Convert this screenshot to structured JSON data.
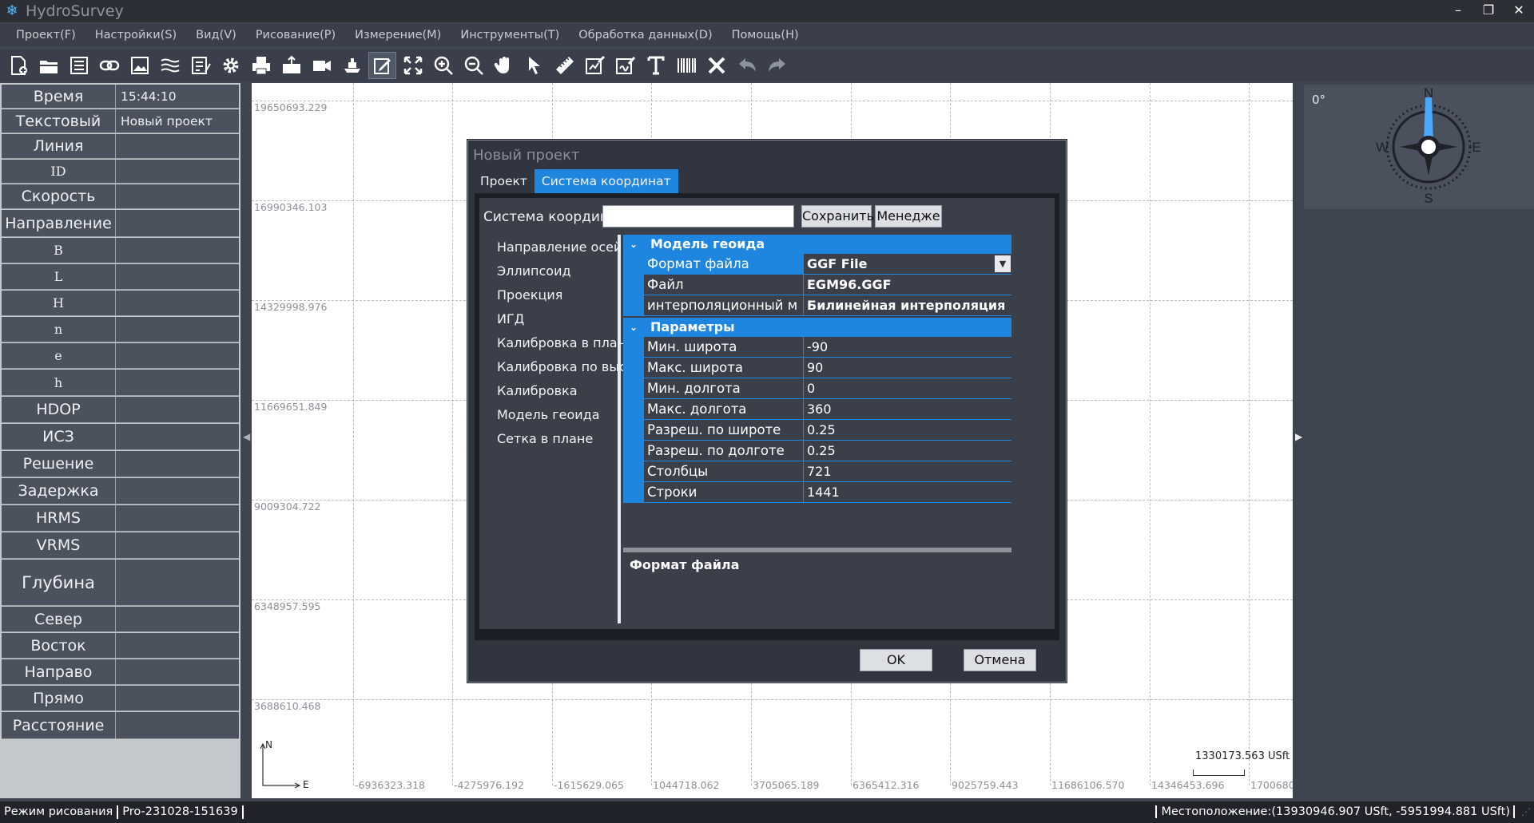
{
  "app": {
    "title": "HydroSurvey"
  },
  "menu": [
    "Проект(F)",
    "Настройки(S)",
    "Вид(V)",
    "Рисование(P)",
    "Измерение(M)",
    "Инструменты(T)",
    "Обработка данных(D)",
    "Помощь(H)"
  ],
  "toolbar_icons": [
    "new-file-icon",
    "open-folder-icon",
    "save-icon",
    "link-icon",
    "image-icon",
    "layers-icon",
    "document-edit-icon",
    "gear-icon",
    "print-icon",
    "export-icon",
    "camera-icon",
    "ship-icon",
    "edit-icon",
    "fullscreen-icon",
    "zoom-in-icon",
    "zoom-out-icon",
    "hand-icon",
    "pointer-icon",
    "ruler-icon",
    "chart-edit-icon",
    "signature-icon",
    "text-icon",
    "barcode-icon",
    "delete-icon",
    "undo-icon",
    "redo-icon"
  ],
  "left_panel": [
    {
      "label": "Время",
      "value": "15:44:10"
    },
    {
      "label": "Текстовый",
      "value": "Новый проект"
    },
    {
      "label": "Линия",
      "value": ""
    },
    {
      "label": "ID",
      "value": ""
    },
    {
      "label": "Скорость",
      "value": ""
    },
    {
      "label": "Направление",
      "value": ""
    },
    {
      "label": "B",
      "value": ""
    },
    {
      "label": "L",
      "value": ""
    },
    {
      "label": "H",
      "value": ""
    },
    {
      "label": "n",
      "value": ""
    },
    {
      "label": "e",
      "value": ""
    },
    {
      "label": "h",
      "value": ""
    },
    {
      "label": "HDOP",
      "value": ""
    },
    {
      "label": "ИСЗ",
      "value": ""
    },
    {
      "label": "Решение",
      "value": ""
    },
    {
      "label": "Задержка",
      "value": ""
    },
    {
      "label": "HRMS",
      "value": ""
    },
    {
      "label": "VRMS",
      "value": ""
    },
    {
      "label": "Глубина",
      "value": ""
    },
    {
      "label": "Север",
      "value": ""
    },
    {
      "label": "Восток",
      "value": ""
    },
    {
      "label": "Направо",
      "value": ""
    },
    {
      "label": "Прямо",
      "value": ""
    },
    {
      "label": "Расстояние",
      "value": ""
    }
  ],
  "canvas": {
    "y_labels": [
      "19650693.229",
      "16990346.103",
      "14329998.976",
      "11669651.849",
      "9009304.722",
      "6348957.595",
      "3688610.468"
    ],
    "x_labels": [
      "-6936323.318",
      "-4275976.192",
      "-1615629.065",
      "1044718.062",
      "3705065.189",
      "6365412.316",
      "9025759.443",
      "11686106.570",
      "14346453.696",
      "1700680"
    ],
    "scale_label": "1330173.563 USft",
    "axis_n": "N",
    "axis_e": "E"
  },
  "compass": {
    "degree": "0°",
    "n": "N",
    "e": "E",
    "s": "S",
    "w": "W"
  },
  "dialog": {
    "title": "Новый проект",
    "tabs": [
      "Проект",
      "Система координат"
    ],
    "active_tab": 1,
    "cs_label": "Система координат",
    "cs_value": "",
    "save_btn": "Сохранить",
    "manager_btn": "Менедже",
    "nav": [
      "Направление осей",
      "Эллипсоид",
      "Проекция",
      "ИГД",
      "Калибровка в плане",
      "Калибровка по высоте",
      "Калибровка",
      "Модель геоида",
      "Сетка в плане"
    ],
    "group1": "Модель геоида",
    "group1_rows": [
      {
        "name": "Формат файла",
        "value": "GGF File"
      },
      {
        "name": "Файл",
        "value": "EGM96.GGF"
      },
      {
        "name": "интерполяционный м",
        "value": "Билинейная интерполяция"
      }
    ],
    "group2": "Параметры",
    "group2_rows": [
      {
        "name": "Мин. широта",
        "value": "-90"
      },
      {
        "name": "Макс. широта",
        "value": "90"
      },
      {
        "name": "Мин. долгота",
        "value": "0"
      },
      {
        "name": "Макс. долгота",
        "value": "360"
      },
      {
        "name": "Разреш. по широте",
        "value": "0.25"
      },
      {
        "name": "Разреш. по долготе",
        "value": "0.25"
      },
      {
        "name": "Столбцы",
        "value": "721"
      },
      {
        "name": "Строки",
        "value": "1441"
      }
    ],
    "desc_title": "Формат файла",
    "ok": "OK",
    "cancel": "Отмена"
  },
  "status": {
    "mode": "Режим рисования",
    "version": "Pro-231028-151639",
    "location": "Местоположение:(13930946.907 USft, -5951994.881 USft)"
  },
  "colors": {
    "accent": "#1f86e0",
    "panel": "#4b525e",
    "background": "#3f4451"
  }
}
